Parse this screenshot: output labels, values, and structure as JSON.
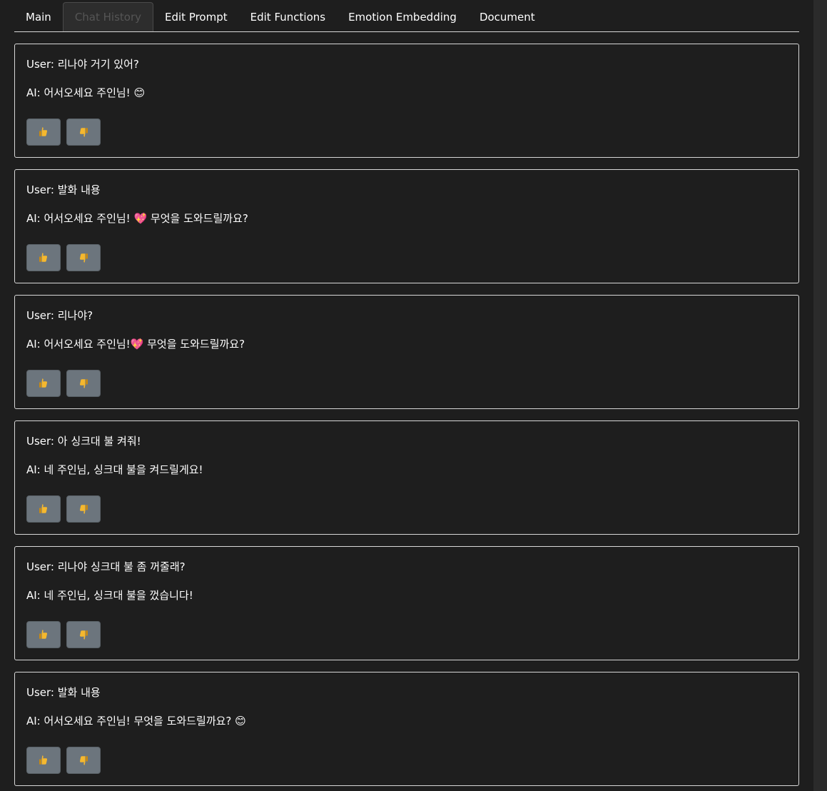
{
  "tabs": [
    {
      "label": "Main",
      "active": false
    },
    {
      "label": "Chat History",
      "active": true
    },
    {
      "label": "Edit Prompt",
      "active": false
    },
    {
      "label": "Edit Functions",
      "active": false
    },
    {
      "label": "Emotion Embedding",
      "active": false
    },
    {
      "label": "Document",
      "active": false
    }
  ],
  "chats": [
    {
      "user": "User: 리나야 거기 있어?",
      "ai": "AI: 어서오세요 주인님! 😊"
    },
    {
      "user": "User: 발화 내용",
      "ai": "AI: 어서오세요 주인님! 💖 무엇을 도와드릴까요?"
    },
    {
      "user": "User: 리나야?",
      "ai": "AI: 어서오세요 주인님!💖 무엇을 도와드릴까요?"
    },
    {
      "user": "User: 아 싱크대 불 켜줘!",
      "ai": "AI: 네 주인님, 싱크대 불을 켜드릴게요!"
    },
    {
      "user": "User: 리나야 싱크대 불 좀 꺼줄래?",
      "ai": "AI: 네 주인님, 싱크대 불을 껐습니다!"
    },
    {
      "user": "User: 발화 내용",
      "ai": "AI: 어서오세요 주인님! 무엇을 도와드릴까요? 😊"
    }
  ],
  "buttons": {
    "like_icon": "thumbs-up-icon",
    "dislike_icon": "thumbs-down-icon"
  },
  "colors": {
    "background": "#1e1e1e",
    "card_border": "#d8d8d8",
    "button_bg": "#6c757d",
    "icon_yellow": "#f5b82e"
  }
}
